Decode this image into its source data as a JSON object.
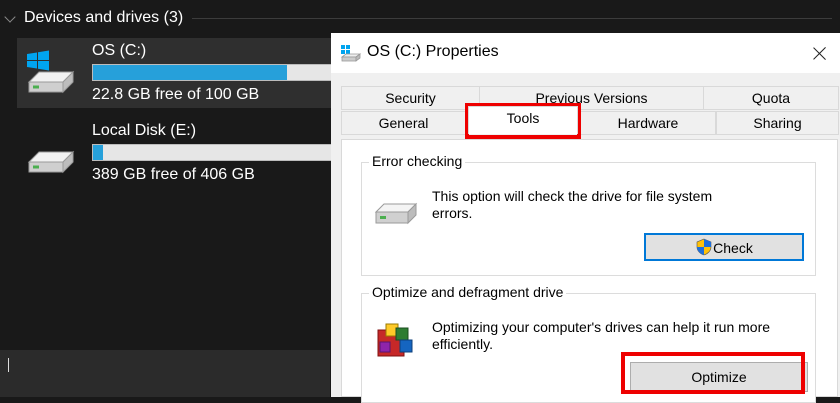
{
  "explorer": {
    "group_title": "Devices and drives (3)",
    "drives": [
      {
        "name": "OS (C:)",
        "free_text": "22.8 GB free of 100 GB",
        "used_fraction": 0.8
      },
      {
        "name": "Local Disk (E:)",
        "free_text": "389 GB free of 406 GB",
        "used_fraction": 0.04
      }
    ]
  },
  "dialog": {
    "title": "OS (C:) Properties",
    "tabs_row1": [
      "Security",
      "Previous Versions",
      "Quota"
    ],
    "tabs_row2": [
      "General",
      "Tools",
      "Hardware",
      "Sharing"
    ],
    "active_tab": "Tools",
    "error_checking": {
      "title": "Error checking",
      "description": "This option will check the drive for file system errors.",
      "button": "Check"
    },
    "optimize": {
      "title": "Optimize and defragment drive",
      "description": "Optimizing your computer's drives can help it run more efficiently.",
      "button": "Optimize"
    }
  },
  "colors": {
    "highlight": "#ee0000",
    "drive_bar_fill": "#26a0da",
    "focus_border": "#0078d7"
  },
  "icons": [
    "chevron-down-icon",
    "windows-drive-icon",
    "drive-icon",
    "drive-small-icon",
    "uac-shield-icon",
    "defrag-icon",
    "close-icon"
  ]
}
